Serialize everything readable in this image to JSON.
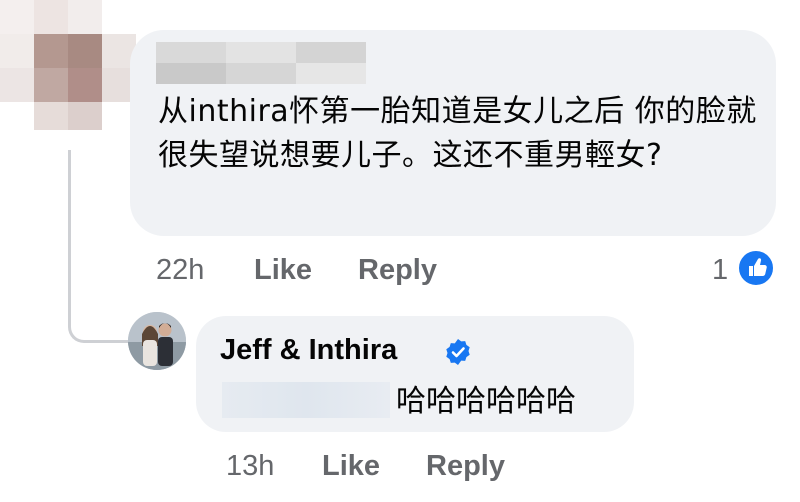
{
  "comment": {
    "text": "从inthira怀第一胎知道是女儿之后 你的脸就很失望说想要儿子。这还不重男輕女?",
    "time": "22h",
    "like_label": "Like",
    "reply_label": "Reply",
    "reaction_count": "1",
    "reaction_icon": "thumbs-up-icon"
  },
  "reply": {
    "author": "Jeff & Inthira",
    "verified_icon": "verified-badge-icon",
    "text": "哈哈哈哈哈哈",
    "time": "13h",
    "like_label": "Like",
    "reply_label": "Reply"
  },
  "colors": {
    "bubble": "#f0f2f5",
    "meta_text": "#65676b",
    "accent_blue": "#1877f2",
    "thread_line": "#ced0d4"
  }
}
